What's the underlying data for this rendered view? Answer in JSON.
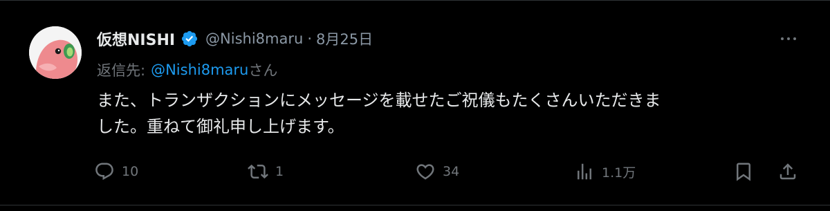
{
  "author": {
    "display_name": "仮想NISHI",
    "handle": "@Nishi8maru",
    "separator": "·",
    "date": "8月25日",
    "avatar_icon": "parrot-avatar-icon",
    "verified_color": "#1d9bf0"
  },
  "reply_to": {
    "prefix": "返信先:",
    "handle": "@Nishi8maru",
    "suffix": "さん"
  },
  "body": {
    "line1": "また、トランザクションにメッセージを載せたご祝儀もたくさんいただきま",
    "line2": "した。重ねて御礼申し上げます。"
  },
  "actions": {
    "reply_count": "10",
    "retweet_count": "1",
    "like_count": "34",
    "view_count": "1.1万"
  },
  "colors": {
    "background": "#000000",
    "text": "#e7e9ea",
    "muted": "#71767b",
    "accent": "#1d9bf0"
  }
}
